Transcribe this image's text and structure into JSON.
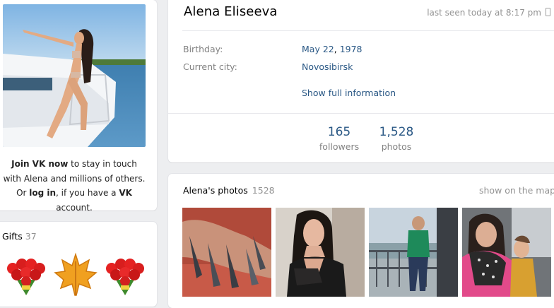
{
  "sidebar": {
    "join_text": {
      "join_link": "Join VK now",
      "part1": " to stay in touch with Alena and millions of others.",
      "or": "Or ",
      "login_link": "log in",
      "part2": ", if you have a ",
      "vk": "VK",
      "part3": " account."
    },
    "gifts": {
      "title": "Gifts",
      "count": "37",
      "items": [
        {
          "icon": "rose-bouquet-icon"
        },
        {
          "icon": "maple-leaf-icon"
        },
        {
          "icon": "rose-bouquet-icon"
        }
      ]
    }
  },
  "profile": {
    "name": "Alena Eliseeva",
    "last_seen": "last seen today at 8:17 pm",
    "birthday_label": "Birthday:",
    "birthday_day": "May 22",
    "birthday_sep": ",",
    "birthday_year": "1978",
    "city_label": "Current city:",
    "city": "Novosibirsk",
    "show_full": "Show full information",
    "stats": [
      {
        "num": "165",
        "caption": "followers"
      },
      {
        "num": "1,528",
        "caption": "photos"
      }
    ]
  },
  "photos": {
    "title": "Alena's photos",
    "count": "1528",
    "map_link": "show on the map"
  },
  "colors": {
    "link": "#2a5885",
    "muted": "#828282",
    "background": "#edeef0"
  }
}
